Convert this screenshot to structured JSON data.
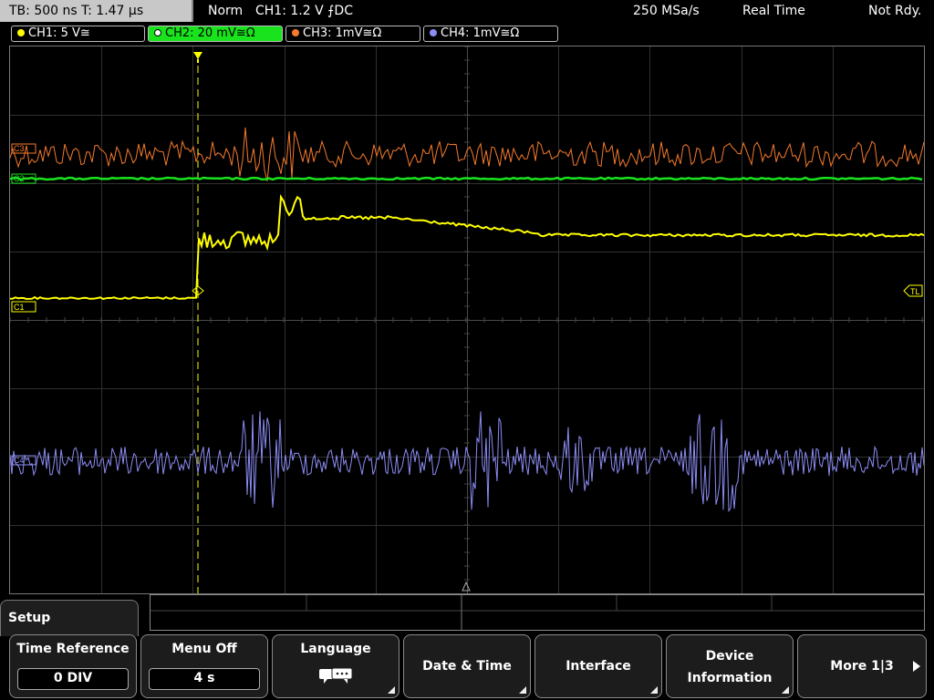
{
  "status_bar": {
    "timebase": "TB: 500 ns   T: 1.47 µs",
    "trigger_mode": "Norm",
    "trigger_info": "CH1: 1.2 V ⨍DC",
    "sample_rate": "250 MSa/s",
    "acq_mode": "Real Time",
    "state": "Not Rdy."
  },
  "channels": [
    {
      "label": "CH1: 5 V≅",
      "color": "#ffff00"
    },
    {
      "label": "CH2: 20 mV≅Ω",
      "color": "#19e31c"
    },
    {
      "label": "CH3: 1mV≅Ω",
      "color": "#f57a2c"
    },
    {
      "label": "CH4: 1mV≅Ω",
      "color": "#8c8cf5"
    }
  ],
  "markers": {
    "ch1": "C1",
    "ch2": "C2",
    "ch3": "C3",
    "ch4": "C4",
    "trigger_level": "TL"
  },
  "menu": {
    "title": "Setup",
    "keys": [
      {
        "label": "Time Reference",
        "value": "0 DIV"
      },
      {
        "label": "Menu Off",
        "value": "4 s"
      },
      {
        "label": "Language",
        "icon": "speech-bubbles-icon"
      },
      {
        "label": "Date & Time"
      },
      {
        "label": "Interface"
      },
      {
        "label_line1": "Device",
        "label_line2": "Information"
      },
      {
        "label": "More 1|3"
      }
    ]
  }
}
